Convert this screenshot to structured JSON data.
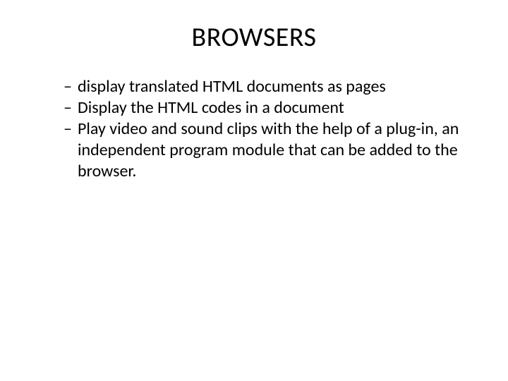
{
  "slide": {
    "title": "BROWSERS",
    "bullets": [
      "display translated HTML documents as pages",
      "Display the HTML codes in a document",
      "Play video and sound clips with the help of a plug-in, an independent program module that can be added to the browser."
    ]
  }
}
